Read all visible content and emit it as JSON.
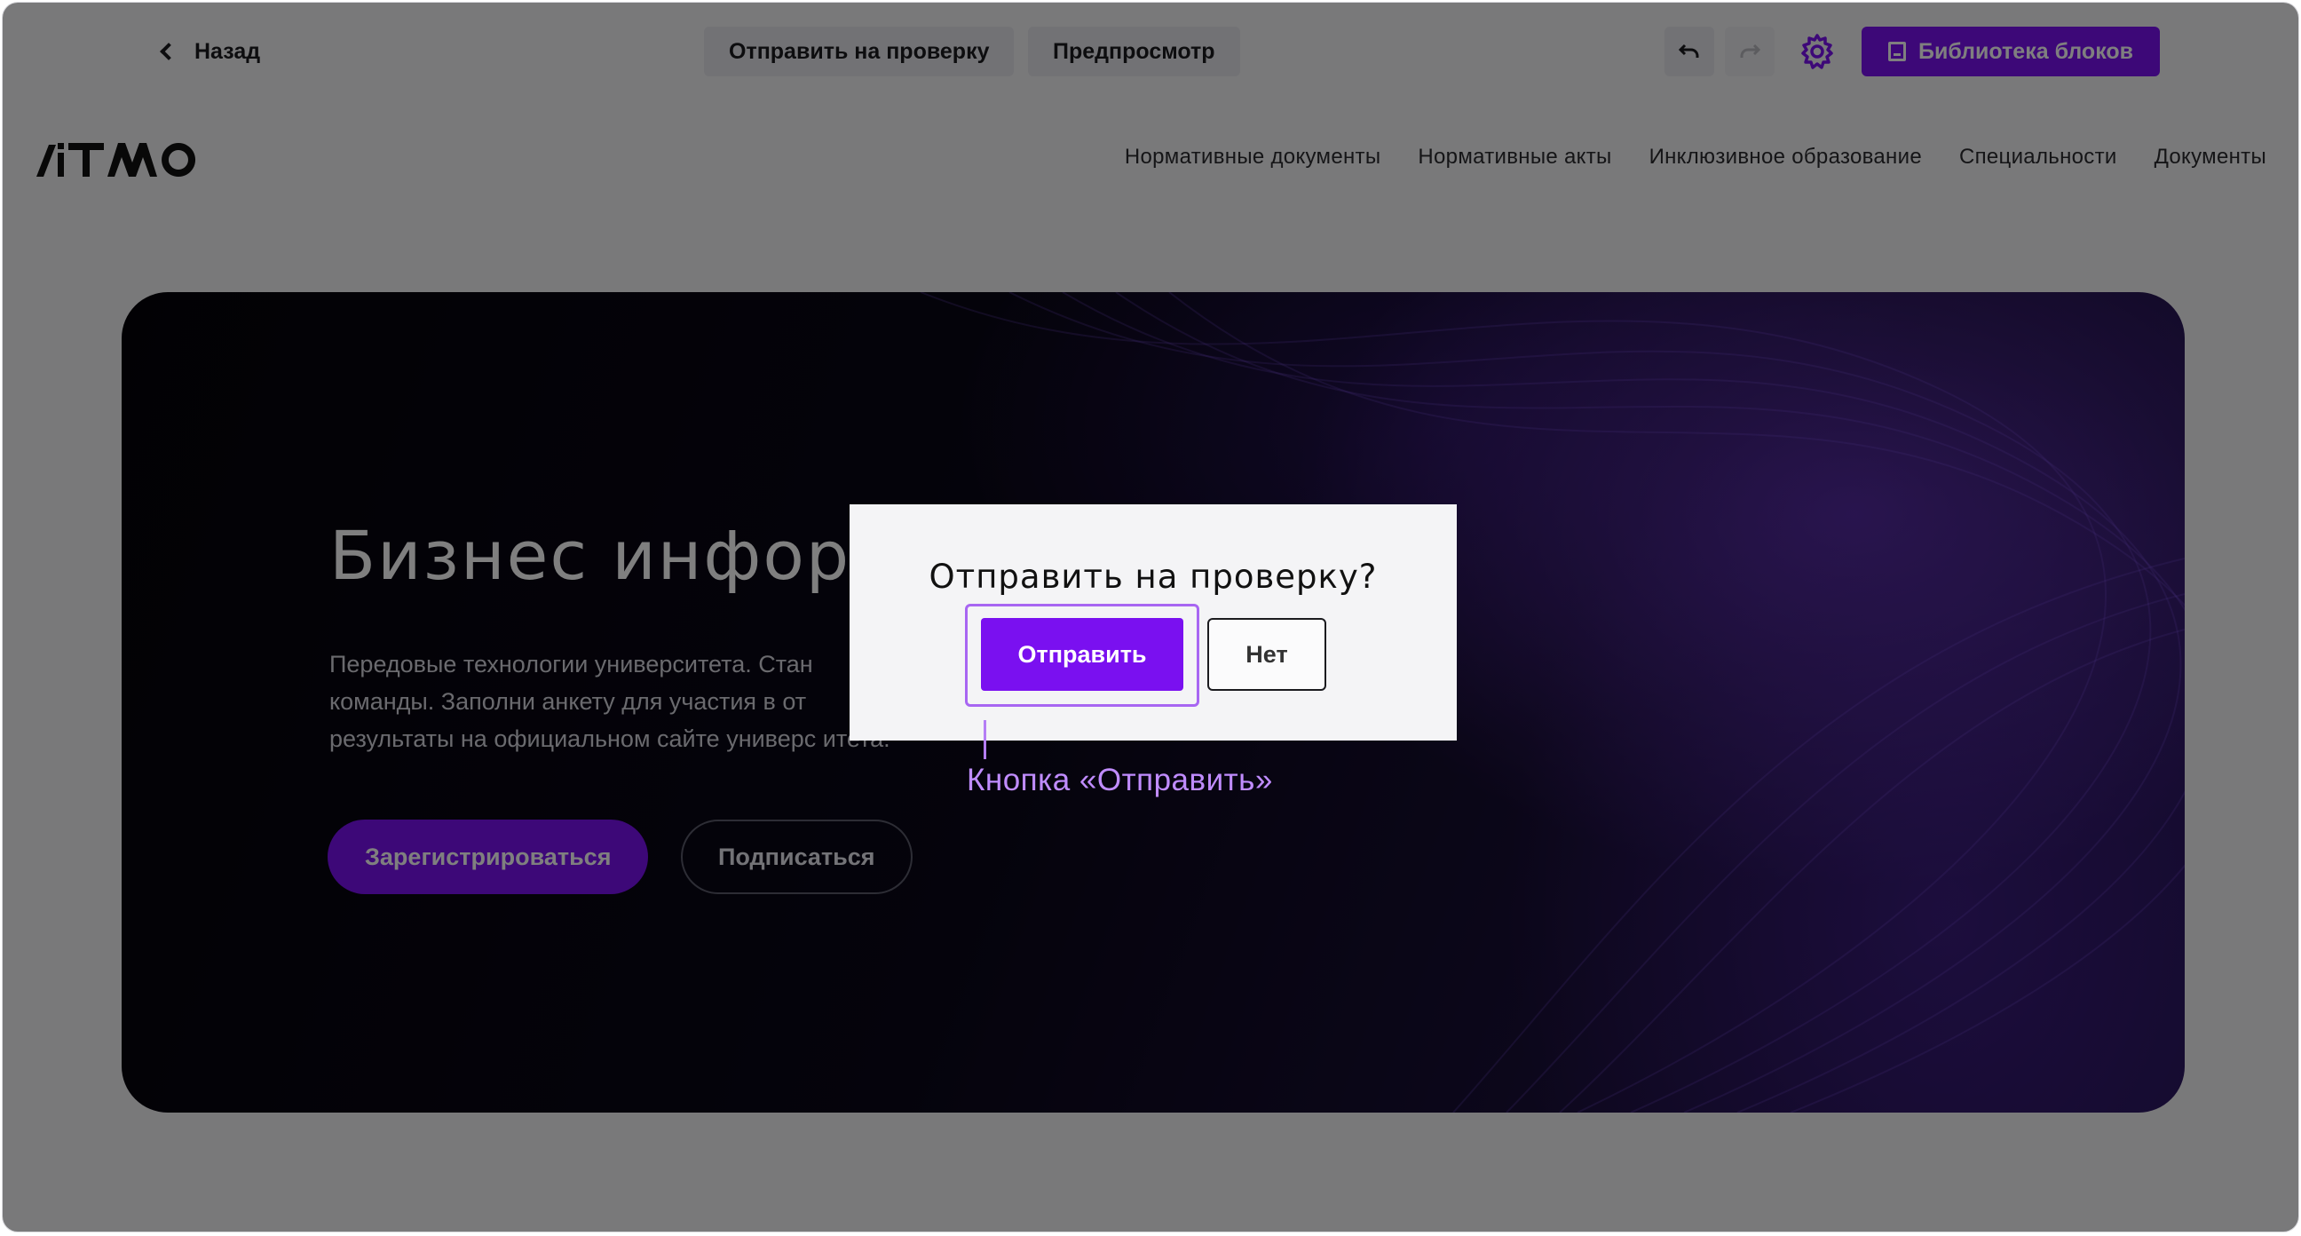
{
  "toolbar": {
    "back_label": "Назад",
    "send_for_review_label": "Отправить на проверку",
    "preview_label": "Предпросмотр",
    "block_library_label": "Библиотека блоков",
    "icons": {
      "back": "chevron-left-icon",
      "undo": "undo-icon",
      "redo": "redo-icon",
      "settings": "gear-icon",
      "library": "book-icon"
    },
    "accent_color": "#7a10f0"
  },
  "site": {
    "logo_text": "ИТМО",
    "nav": [
      "Нормативные документы",
      "Нормативные акты",
      "Инклюзивное образование",
      "Специальности",
      "Документы"
    ]
  },
  "hero": {
    "title": "Бизнес инфор",
    "text_lines": [
      "Передовые технологии университета. Стан",
      "команды. Заполни анкету для участия в от",
      "результаты на официальном сайте универс итета."
    ],
    "register_label": "Зарегистрироваться",
    "subscribe_label": "Подписаться"
  },
  "dialog": {
    "title": "Отправить на проверку?",
    "confirm_label": "Отправить",
    "cancel_label": "Нет"
  },
  "annotation": {
    "text": "Кнопка  «Отправить»",
    "color": "#c08cff"
  }
}
